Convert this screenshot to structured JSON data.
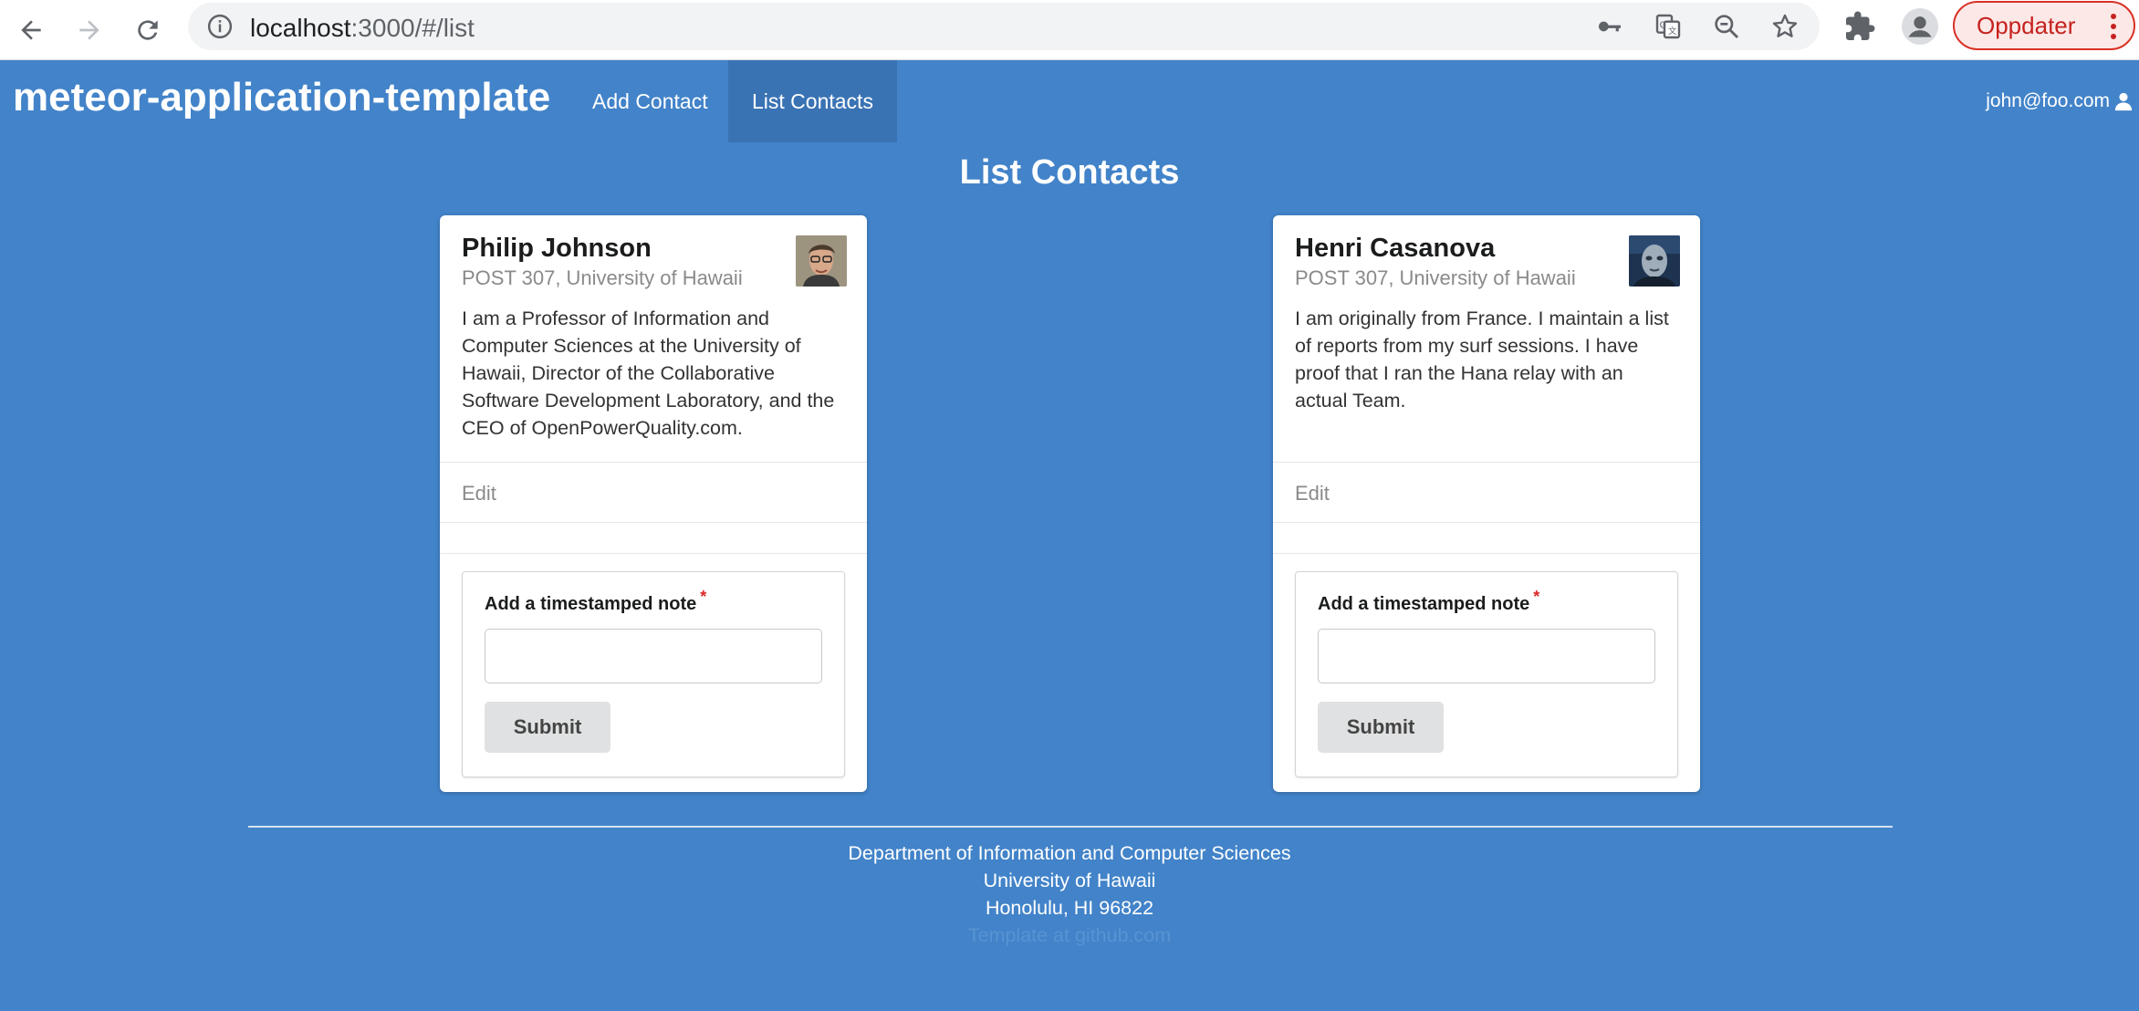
{
  "browser": {
    "url_host": "localhost",
    "url_path": ":3000/#/list",
    "update_label": "Oppdater"
  },
  "navbar": {
    "brand": "meteor-application-template",
    "items": [
      {
        "label": "Add Contact",
        "active": false
      },
      {
        "label": "List Contacts",
        "active": true
      }
    ],
    "user": "john@foo.com"
  },
  "page": {
    "title": "List Contacts"
  },
  "contacts": [
    {
      "name": "Philip Johnson",
      "address": "POST 307, University of Hawaii",
      "description": "I am a Professor of Information and Computer Sciences at the University of Hawaii, Director of the Collaborative Software Development Laboratory, and the CEO of OpenPowerQuality.com.",
      "edit_label": "Edit",
      "note_label": "Add a timestamped note",
      "required_mark": "*",
      "note_value": "",
      "submit_label": "Submit"
    },
    {
      "name": "Henri Casanova",
      "address": "POST 307, University of Hawaii",
      "description": "I am originally from France. I maintain a list of reports from my surf sessions. I have proof that I ran the Hana relay with an actual Team.",
      "edit_label": "Edit",
      "note_label": "Add a timestamped note",
      "required_mark": "*",
      "note_value": "",
      "submit_label": "Submit"
    }
  ],
  "footer": {
    "lines": [
      "Department of Information and Computer Sciences",
      "University of Hawaii",
      "Honolulu, HI 96822"
    ],
    "faint_line": "Template at github.com"
  },
  "colors": {
    "page_background": "#4283c9",
    "active_nav": "#3a73b4",
    "required": "#db2828",
    "update_button": "#c5221f"
  }
}
